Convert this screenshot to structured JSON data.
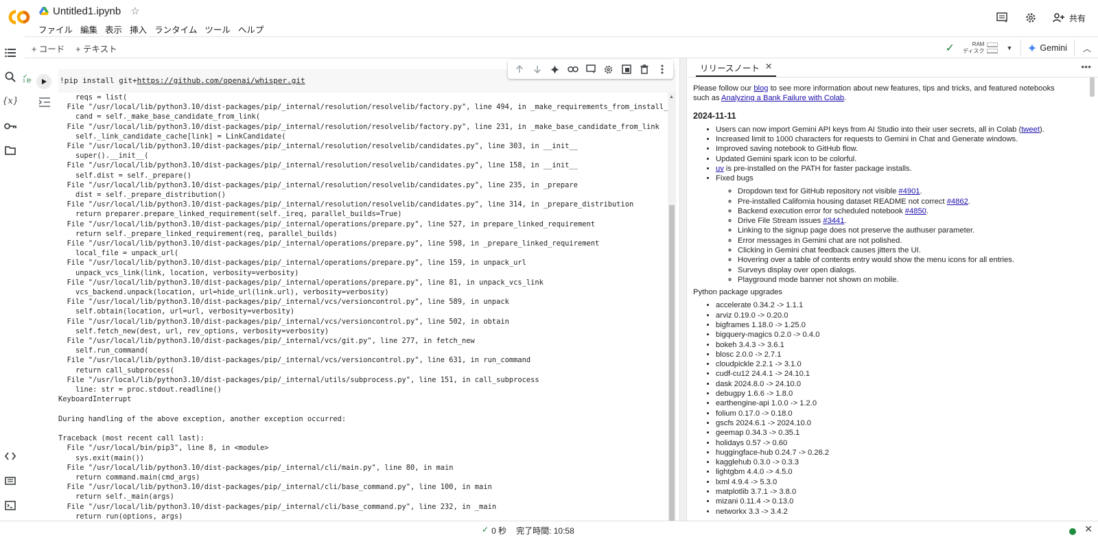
{
  "header": {
    "title": "Untitled1.ipynb",
    "menus": [
      "ファイル",
      "編集",
      "表示",
      "挿入",
      "ランタイム",
      "ツール",
      "ヘルプ"
    ],
    "share_label": "共有"
  },
  "toolbar": {
    "add_code": "+ コード",
    "add_text": "+ テキスト",
    "ram_label": "RAM",
    "disk_label": "ディスク",
    "gemini_label": "Gemini"
  },
  "cell": {
    "exec_time": "1 秒",
    "code_prefix": "!pip install git+",
    "code_url": "https://github.com/openai/whisper.git",
    "output_lines": [
      "    reqs = list(",
      "  File \"/usr/local/lib/python3.10/dist-packages/pip/_internal/resolution/resolvelib/factory.py\", line 494, in _make_requirements_from_install_req",
      "    cand = self._make_base_candidate_from_link(",
      "  File \"/usr/local/lib/python3.10/dist-packages/pip/_internal/resolution/resolvelib/factory.py\", line 231, in _make_base_candidate_from_link",
      "    self._link_candidate_cache[link] = LinkCandidate(",
      "  File \"/usr/local/lib/python3.10/dist-packages/pip/_internal/resolution/resolvelib/candidates.py\", line 303, in __init__",
      "    super().__init__(",
      "  File \"/usr/local/lib/python3.10/dist-packages/pip/_internal/resolution/resolvelib/candidates.py\", line 158, in __init__",
      "    self.dist = self._prepare()",
      "  File \"/usr/local/lib/python3.10/dist-packages/pip/_internal/resolution/resolvelib/candidates.py\", line 235, in _prepare",
      "    dist = self._prepare_distribution()",
      "  File \"/usr/local/lib/python3.10/dist-packages/pip/_internal/resolution/resolvelib/candidates.py\", line 314, in _prepare_distribution",
      "    return preparer.prepare_linked_requirement(self._ireq, parallel_builds=True)",
      "  File \"/usr/local/lib/python3.10/dist-packages/pip/_internal/operations/prepare.py\", line 527, in prepare_linked_requirement",
      "    return self._prepare_linked_requirement(req, parallel_builds)",
      "  File \"/usr/local/lib/python3.10/dist-packages/pip/_internal/operations/prepare.py\", line 598, in _prepare_linked_requirement",
      "    local_file = unpack_url(",
      "  File \"/usr/local/lib/python3.10/dist-packages/pip/_internal/operations/prepare.py\", line 159, in unpack_url",
      "    unpack_vcs_link(link, location, verbosity=verbosity)",
      "  File \"/usr/local/lib/python3.10/dist-packages/pip/_internal/operations/prepare.py\", line 81, in unpack_vcs_link",
      "    vcs_backend.unpack(location, url=hide_url(link.url), verbosity=verbosity)",
      "  File \"/usr/local/lib/python3.10/dist-packages/pip/_internal/vcs/versioncontrol.py\", line 589, in unpack",
      "    self.obtain(location, url=url, verbosity=verbosity)",
      "  File \"/usr/local/lib/python3.10/dist-packages/pip/_internal/vcs/versioncontrol.py\", line 502, in obtain",
      "    self.fetch_new(dest, url, rev_options, verbosity=verbosity)",
      "  File \"/usr/local/lib/python3.10/dist-packages/pip/_internal/vcs/git.py\", line 277, in fetch_new",
      "    self.run_command(",
      "  File \"/usr/local/lib/python3.10/dist-packages/pip/_internal/vcs/versioncontrol.py\", line 631, in run_command",
      "    return call_subprocess(",
      "  File \"/usr/local/lib/python3.10/dist-packages/pip/_internal/utils/subprocess.py\", line 151, in call_subprocess",
      "    line: str = proc.stdout.readline()",
      "KeyboardInterrupt",
      "",
      "During handling of the above exception, another exception occurred:",
      "",
      "Traceback (most recent call last):",
      "  File \"/usr/local/bin/pip3\", line 8, in <module>",
      "    sys.exit(main())",
      "  File \"/usr/local/lib/python3.10/dist-packages/pip/_internal/cli/main.py\", line 80, in main",
      "    return command.main(cmd_args)",
      "  File \"/usr/local/lib/python3.10/dist-packages/pip/_internal/cli/base_command.py\", line 100, in main",
      "    return self._main(args)",
      "  File \"/usr/local/lib/python3.10/dist-packages/pip/_internal/cli/base_command.py\", line 232, in _main",
      "    return run(options, args)"
    ]
  },
  "release_notes": {
    "tab_label": "リリースノート",
    "intro_1": "Please follow our ",
    "intro_blog": "blog",
    "intro_2": " to see more information about new features, tips and tricks, and featured notebooks such as ",
    "intro_link": "Analyzing a Bank Failure with Colab",
    "intro_3": ".",
    "date": "2024-11-11",
    "items": [
      {
        "text": "Users can now import Gemini API keys from AI Studio into their user secrets, all in Colab (",
        "link": "tweet",
        "after": ")."
      },
      {
        "text": "Increased limit to 1000 characters for requests to Gemini in Chat and Generate windows.",
        "link": "",
        "after": ""
      },
      {
        "text": "Improved saving notebook to GitHub flow.",
        "link": "",
        "after": ""
      },
      {
        "text": "Updated Gemini spark icon to be colorful.",
        "link": "",
        "after": ""
      },
      {
        "text": "",
        "link": "uv",
        "after": " is pre-installed on the PATH for faster package installs."
      },
      {
        "text": "Fixed bugs",
        "link": "",
        "after": ""
      }
    ],
    "bugs": [
      {
        "text": "Dropdown text for GitHub repository not visible ",
        "link": "#4901",
        "after": "."
      },
      {
        "text": "Pre-installed California housing dataset README not correct ",
        "link": "#4862",
        "after": "."
      },
      {
        "text": "Backend execution error for scheduled notebook ",
        "link": "#4850",
        "after": "."
      },
      {
        "text": "Drive File Stream issues ",
        "link": "#3441",
        "after": "."
      },
      {
        "text": "Linking to the signup page does not preserve the authuser parameter.",
        "link": "",
        "after": ""
      },
      {
        "text": "Error messages in Gemini chat are not polished.",
        "link": "",
        "after": ""
      },
      {
        "text": "Clicking in Gemini chat feedback causes jitters the UI.",
        "link": "",
        "after": ""
      },
      {
        "text": "Hovering over a table of contents entry would show the menu icons for all entries.",
        "link": "",
        "after": ""
      },
      {
        "text": "Surveys display over open dialogs.",
        "link": "",
        "after": ""
      },
      {
        "text": "Playground mode banner not shown on mobile.",
        "link": "",
        "after": ""
      }
    ],
    "pkg_heading": "Python package upgrades",
    "packages": [
      "accelerate 0.34.2 -> 1.1.1",
      "arviz 0.19.0 -> 0.20.0",
      "bigframes 1.18.0 -> 1.25.0",
      "bigquery-magics 0.2.0 -> 0.4.0",
      "bokeh 3.4.3 -> 3.6.1",
      "blosc 2.0.0 -> 2.7.1",
      "cloudpickle 2.2.1 -> 3.1.0",
      "cudf-cu12 24.4.1 -> 24.10.1",
      "dask 2024.8.0 -> 24.10.0",
      "debugpy 1.6.6 -> 1.8.0",
      "earthengine-api 1.0.0 -> 1.2.0",
      "folium 0.17.0 -> 0.18.0",
      "gscfs 2024.6.1 -> 2024.10.0",
      "geemap 0.34.3 -> 0.35.1",
      "holidays 0.57 -> 0.60",
      "huggingface-hub 0.24.7 -> 0.26.2",
      "kagglehub 0.3.0 -> 0.3.3",
      "lightgbm 4.4.0 -> 4.5.0",
      "lxml 4.9.4 -> 5.3.0",
      "matplotlib 3.7.1 -> 3.8.0",
      "mizani 0.11.4 -> 0.13.0",
      "networkx 3.3 -> 3.4.2"
    ]
  },
  "statusbar": {
    "duration": "0 秒",
    "completed": "完了時間: 10:58"
  },
  "colors": {
    "accent_green": "#188038",
    "link": "#1a0dab",
    "logo_orange": "#F9AB00",
    "logo_dark_orange": "#E8710A"
  }
}
